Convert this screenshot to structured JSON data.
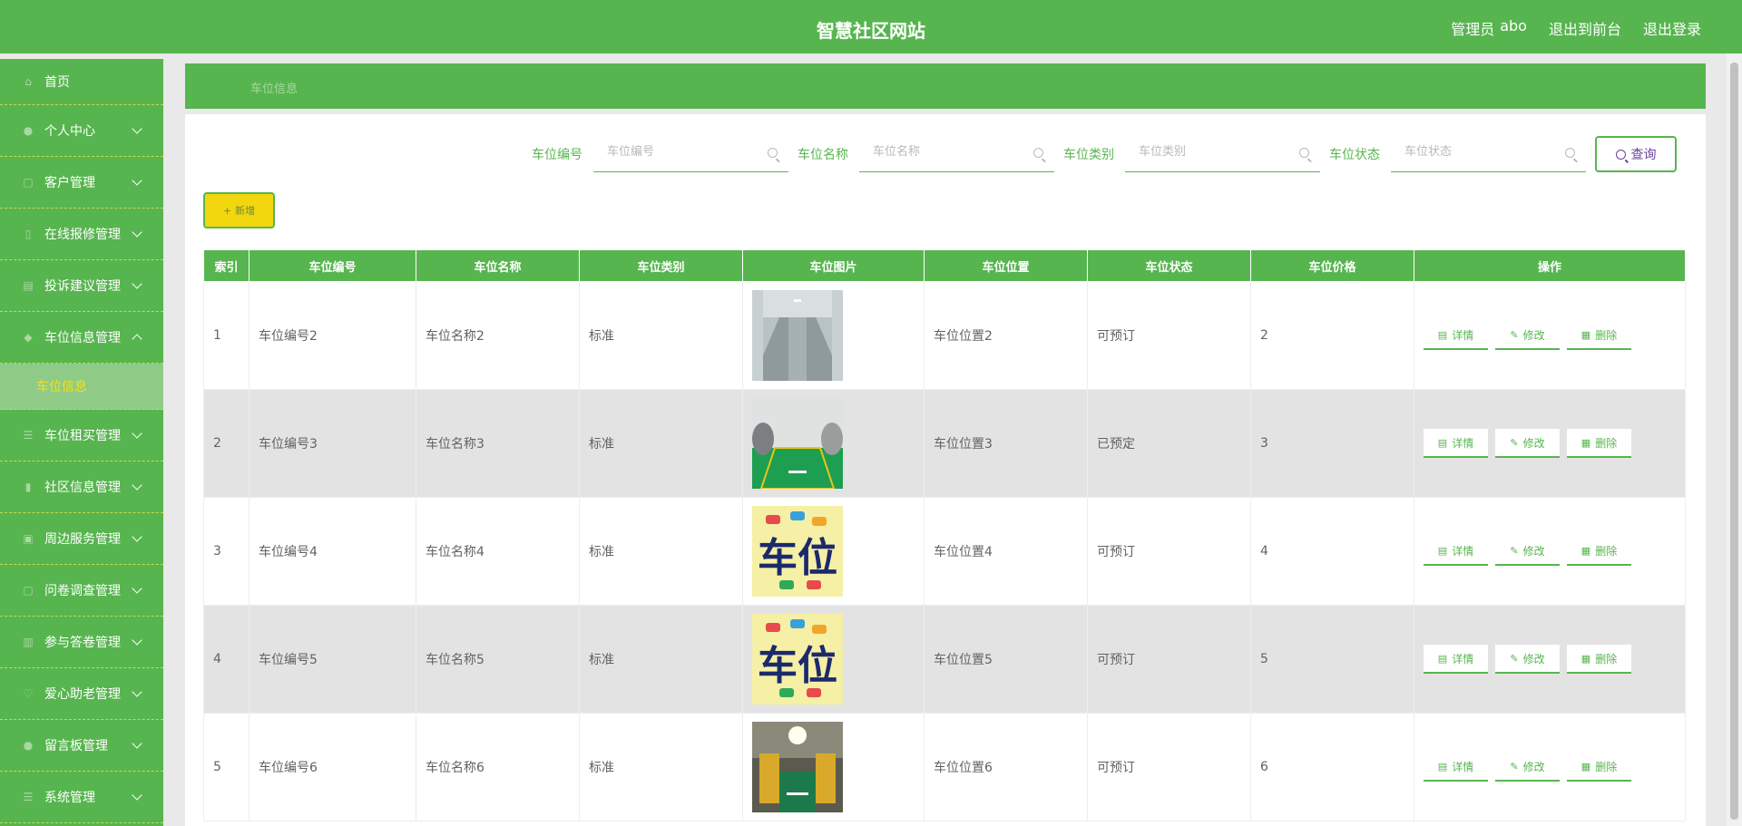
{
  "header": {
    "site_title": "智慧社区网站",
    "role_label": "管理员",
    "username": "abo",
    "to_front_label": "退出到前台",
    "logout_label": "退出登录"
  },
  "sidebar": {
    "items": [
      {
        "label": "首页",
        "icon": "home-icon"
      },
      {
        "label": "个人中心",
        "icon": "user-icon"
      },
      {
        "label": "客户管理",
        "icon": "customers-icon"
      },
      {
        "label": "在线报修管理",
        "icon": "repair-icon"
      },
      {
        "label": "投诉建议管理",
        "icon": "complaint-icon"
      },
      {
        "label": "车位信息管理",
        "icon": "parking-icon",
        "expanded": true
      },
      {
        "label": "车位租买管理",
        "icon": "list-icon"
      },
      {
        "label": "社区信息管理",
        "icon": "community-icon"
      },
      {
        "label": "周边服务管理",
        "icon": "service-icon"
      },
      {
        "label": "问卷调查管理",
        "icon": "survey-icon"
      },
      {
        "label": "参与答卷管理",
        "icon": "chart-icon"
      },
      {
        "label": "爱心助老管理",
        "icon": "heart-icon"
      },
      {
        "label": "留言板管理",
        "icon": "message-icon"
      },
      {
        "label": "系统管理",
        "icon": "settings-icon"
      }
    ],
    "active_sub": "车位信息"
  },
  "breadcrumb": {
    "current": "车位信息"
  },
  "search": {
    "fields": [
      {
        "label": "车位编号",
        "placeholder": "车位编号"
      },
      {
        "label": "车位名称",
        "placeholder": "车位名称"
      },
      {
        "label": "车位类别",
        "placeholder": "车位类别"
      },
      {
        "label": "车位状态",
        "placeholder": "车位状态"
      }
    ],
    "query_label": "查询"
  },
  "toolbar": {
    "add_label": "新增"
  },
  "table": {
    "headers": [
      "索引",
      "车位编号",
      "车位名称",
      "车位类别",
      "车位图片",
      "车位位置",
      "车位状态",
      "车位价格",
      "操作"
    ],
    "rows": [
      {
        "index": "1",
        "code": "车位编号2",
        "name": "车位名称2",
        "type": "标准",
        "image": "garage-lane",
        "location": "车位位置2",
        "status": "可预订",
        "price": "2"
      },
      {
        "index": "2",
        "code": "车位编号3",
        "name": "车位名称3",
        "type": "标准",
        "image": "green-spot",
        "location": "车位位置3",
        "status": "已预定",
        "price": "3"
      },
      {
        "index": "3",
        "code": "车位编号4",
        "name": "车位名称4",
        "type": "标准",
        "image": "cartoon-sign",
        "location": "车位位置4",
        "status": "可预订",
        "price": "4"
      },
      {
        "index": "4",
        "code": "车位编号5",
        "name": "车位名称5",
        "type": "标准",
        "image": "cartoon-sign",
        "location": "车位位置5",
        "status": "可预订",
        "price": "5"
      },
      {
        "index": "5",
        "code": "车位编号6",
        "name": "车位名称6",
        "type": "标准",
        "image": "lit-spot",
        "location": "车位位置6",
        "status": "可预订",
        "price": "6"
      }
    ],
    "actions": {
      "detail": "详情",
      "edit": "修改",
      "delete": "删除"
    }
  },
  "theme": {
    "primary": "#57b54f",
    "accent_yellow": "#f2d70e",
    "query_text": "#6b3fa0"
  },
  "sign_text": "车位"
}
